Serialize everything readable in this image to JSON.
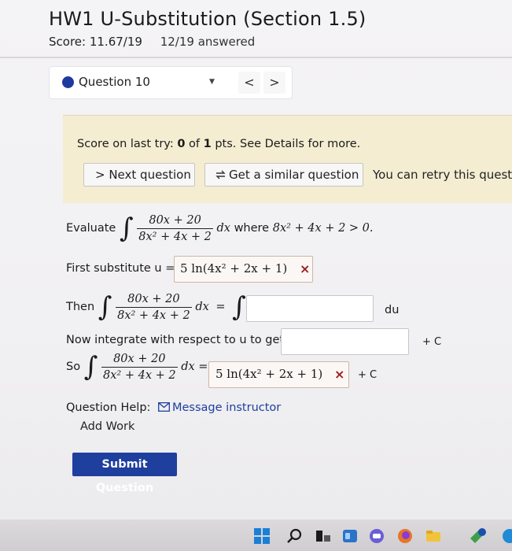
{
  "header": {
    "title": "HW1 U-Substitution (Section 1.5)",
    "score": "Score: 11.67/19",
    "answered": "12/19 answered"
  },
  "question_nav": {
    "label": "Question 10",
    "prev": "<",
    "next": ">"
  },
  "banner": {
    "score_prefix": "Score on last try: ",
    "score_value": "0",
    "score_mid": " of ",
    "score_total": "1",
    "score_suffix": " pts. See Details for more.",
    "next_button": "> Next question",
    "similar_button": "Get a similar question",
    "retry_text": "You can retry this questio"
  },
  "problem": {
    "evaluate_label": "Evaluate",
    "integrand_num": "80x + 20",
    "integrand_den": "8x² + 4x + 2",
    "dx": "dx",
    "where_text": "where",
    "condition": "8x² + 4x + 2 > 0.",
    "first_sub_label": "First substitute u =",
    "u_answer": "5 ln(4x² + 2x + 1)",
    "then_label": "Then",
    "equals": "=",
    "du_label": "du",
    "integrate_label": "Now integrate with respect to u to get",
    "plus_c": "+ C",
    "so_label": "So",
    "equals_short": "=",
    "final_answer": "5 ln(4x² + 2x + 1)",
    "plus_c_final": "+ C",
    "wrong_mark": "×"
  },
  "help": {
    "label": "Question Help:",
    "message_link": "Message instructor",
    "add_work": "Add Work"
  },
  "submit_label": "Submit Question",
  "colors": {
    "accent": "#1e3f9e",
    "banner": "#f4edd2",
    "error": "#9b1d1d"
  }
}
